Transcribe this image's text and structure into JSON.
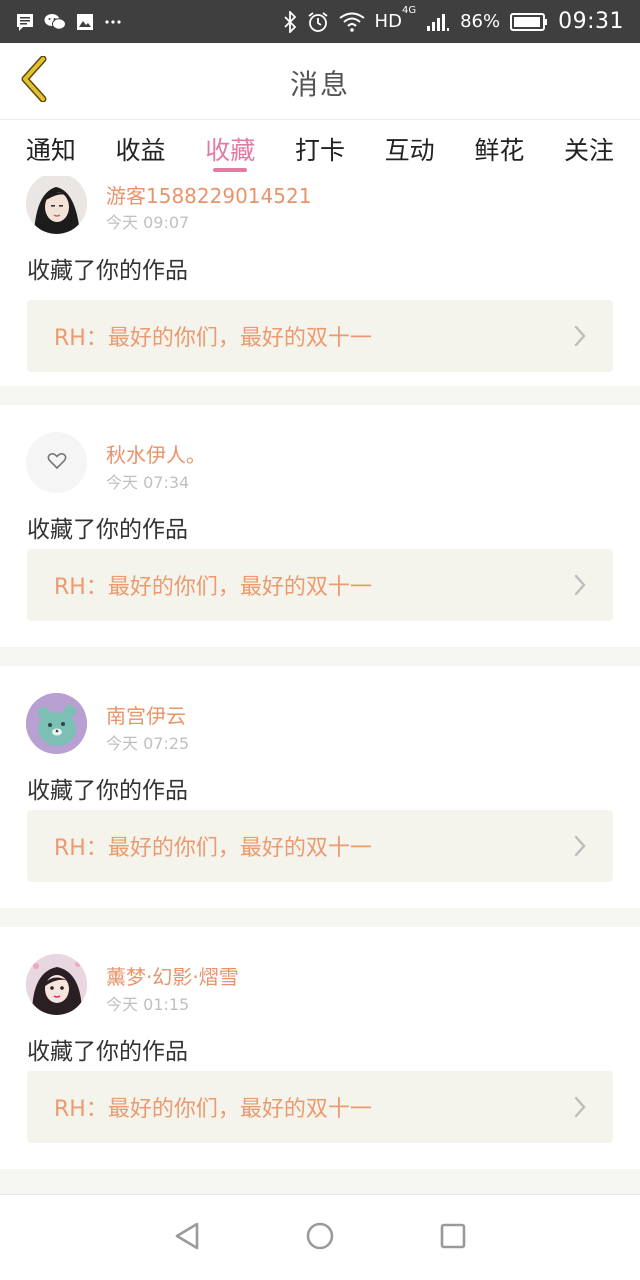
{
  "status_bar": {
    "network": "HD",
    "network_type": "4G",
    "battery": "86%",
    "time": "09:31",
    "left_icons": [
      "message-icon",
      "wechat-icon",
      "image-icon",
      "more-icon"
    ],
    "right_icons": [
      "bluetooth-icon",
      "alarm-icon",
      "wifi-icon",
      "signal-icon",
      "battery-icon"
    ]
  },
  "header": {
    "title": "消息",
    "back_icon": "chevron-left-icon",
    "accent_color": "#e5c02f"
  },
  "tabs": [
    {
      "label": "通知",
      "active": false
    },
    {
      "label": "收益",
      "active": false
    },
    {
      "label": "收藏",
      "active": true
    },
    {
      "label": "打卡",
      "active": false
    },
    {
      "label": "互动",
      "active": false
    },
    {
      "label": "鲜花",
      "active": false
    },
    {
      "label": "关注",
      "active": false
    }
  ],
  "colors": {
    "tab_active": "#e47aa4",
    "username": "#e8936a",
    "link_text": "#ec9a70",
    "link_bg": "#f4f4ec"
  },
  "messages": [
    {
      "user": "游客1588229014521",
      "time": "今天 09:07",
      "text": "收藏了你的作品",
      "work": "RH：最好的你们，最好的双十一",
      "avatar": "photo-avatar"
    },
    {
      "user": "秋水伊人。",
      "time": "今天 07:34",
      "text": "收藏了你的作品",
      "work": "RH：最好的你们，最好的双十一",
      "avatar": "heart-avatar"
    },
    {
      "user": "南宫伊云",
      "time": "今天 07:25",
      "text": "收藏了你的作品",
      "work": "RH：最好的你们，最好的双十一",
      "avatar": "bear-avatar"
    },
    {
      "user": "薰梦·幻影·熠雪",
      "time": "今天 01:15",
      "text": "收藏了你的作品",
      "work": "RH：最好的你们，最好的双十一",
      "avatar": "photo-avatar"
    }
  ],
  "nav_bar": {
    "icons": [
      "back-triangle-icon",
      "home-circle-icon",
      "recents-square-icon"
    ]
  }
}
